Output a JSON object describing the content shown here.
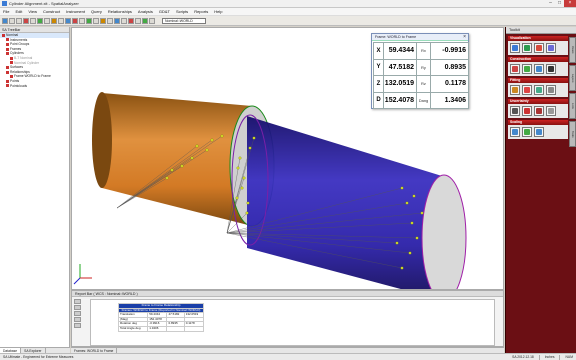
{
  "window": {
    "title": "Cylinder Alignment.xit - SpatialAnalyzer"
  },
  "menu": [
    "File",
    "Edit",
    "View",
    "Construct",
    "Instrument",
    "Query",
    "Relationships",
    "Analysis",
    "GD&T",
    "Scripts",
    "Reports",
    "Help"
  ],
  "toolbar": {
    "frame_combo": "Nominal::WORLD"
  },
  "tree": {
    "header": "SA TreeBar",
    "items": [
      {
        "label": "Nominal",
        "level": 0,
        "sel": true
      },
      {
        "label": "Instruments",
        "level": 1
      },
      {
        "label": "Point Groups",
        "level": 1
      },
      {
        "label": "Frames",
        "level": 1
      },
      {
        "label": "Cylinders",
        "level": 1
      },
      {
        "label": "B-T Nominal",
        "level": 2,
        "dim": true
      },
      {
        "label": "Nominal Cylinder",
        "level": 2,
        "dim": true
      },
      {
        "label": "Surfaces",
        "level": 1
      },
      {
        "label": "Relationships",
        "level": 1
      },
      {
        "label": "Frame WORLD to Frame",
        "level": 2
      },
      {
        "label": "Points",
        "level": 1
      },
      {
        "label": "Pointclouds",
        "level": 1
      }
    ],
    "tabs": [
      "Database",
      "SA Explorer"
    ]
  },
  "xform": {
    "title": "Frame: WORLD to Frame",
    "rows": [
      {
        "axis": "X",
        "value": "59.4344",
        "rlabel": "Rx",
        "rvalue": "-0.9916"
      },
      {
        "axis": "Y",
        "value": "47.5182",
        "rlabel": "Ry",
        "rvalue": "0.8935"
      },
      {
        "axis": "Z",
        "value": "132.0519",
        "rlabel": "Rz",
        "rvalue": "0.1178"
      },
      {
        "axis": "D",
        "value": "152.4078",
        "rlabel": "Dang",
        "rvalue": "1.3406"
      }
    ]
  },
  "report": {
    "header": "Report Bar ( WCS : Nominal::WORLD )",
    "title1": "Frame to Frame Relationship",
    "title2": "Frames: WORLD to Frame (Reported in Nominal::WORLD)",
    "rows": [
      {
        "label": "Translation",
        "c1": "59.4344",
        "c2": "47.5182",
        "c3": "132.0519"
      },
      {
        "label": "(Mag)",
        "c1": "152.4078",
        "c2": "",
        "c3": ""
      },
      {
        "label": "Rotation deg",
        "c1": "-0.9916",
        "c2": "0.8935",
        "c3": "0.1178"
      },
      {
        "label": "Total Angle deg",
        "c1": "1.3406",
        "c2": "",
        "c3": ""
      }
    ],
    "tab": "Frames: WORLD to Frame"
  },
  "status": {
    "left": "SA Ultimate - Engineered for Extreme Measures",
    "version": "SA 2012.12.18",
    "units": "Inches",
    "mode": "NUM"
  },
  "toolkit": {
    "header": "Toolkit",
    "groups": [
      {
        "name": "Visualization",
        "buttons": [
          "#3c7bd6",
          "#2c9b4f",
          "#d64b3c",
          "#6b6bd6"
        ]
      },
      {
        "name": "Construction",
        "buttons": [
          "#c44",
          "#4a4",
          "#48c",
          "#333"
        ]
      },
      {
        "name": "Fitting",
        "buttons": [
          "#c82",
          "#d44",
          "#4a8",
          "#888"
        ]
      },
      {
        "name": "Uncertainty",
        "buttons": [
          "#555",
          "#c33",
          "#a33",
          "#999"
        ]
      },
      {
        "name": "Scaling",
        "buttons": [
          "#48c",
          "#4a4",
          "#48c"
        ]
      }
    ],
    "side_tabs": [
      "Views",
      "Layers",
      "Lists",
      "Tools"
    ]
  },
  "colors": {
    "toolkit_bg": "#6b0f14",
    "orange_cylinder": "#d9802f",
    "blue_cylinder": "#2a1fa8"
  }
}
